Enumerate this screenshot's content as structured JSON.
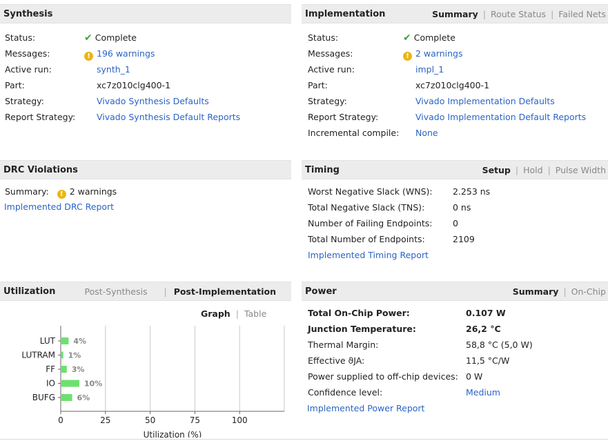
{
  "synthesis": {
    "title": "Synthesis",
    "rows": [
      {
        "label": "Status:",
        "value": "Complete",
        "icon": "check-icon"
      },
      {
        "label": "Messages:",
        "value": "196 warnings",
        "icon": "warning-icon",
        "link": true
      },
      {
        "label": "Active run:",
        "value": "synth_1",
        "link": true
      },
      {
        "label": "Part:",
        "value": "xc7z010clg400-1"
      },
      {
        "label": "Strategy:",
        "value": "Vivado Synthesis Defaults",
        "link": true
      },
      {
        "label": "Report Strategy:",
        "value": "Vivado Synthesis Default Reports",
        "link": true
      }
    ]
  },
  "implementation": {
    "title": "Implementation",
    "tabs": [
      "Summary",
      "Route Status",
      "Failed Nets"
    ],
    "active_tab": "Summary",
    "rows": [
      {
        "label": "Status:",
        "value": "Complete",
        "icon": "check-icon"
      },
      {
        "label": "Messages:",
        "value": "2 warnings",
        "icon": "warning-icon",
        "link": true
      },
      {
        "label": "Active run:",
        "value": "impl_1",
        "link": true
      },
      {
        "label": "Part:",
        "value": "xc7z010clg400-1"
      },
      {
        "label": "Strategy:",
        "value": "Vivado Implementation Defaults",
        "link": true
      },
      {
        "label": "Report Strategy:",
        "value": "Vivado Implementation Default Reports",
        "link": true
      },
      {
        "label": "Incremental compile:",
        "value": "None",
        "link": true
      }
    ]
  },
  "drc": {
    "title": "DRC Violations",
    "summary_label": "Summary:",
    "summary_value": "2 warnings",
    "report_link": "Implemented DRC Report"
  },
  "timing": {
    "title": "Timing",
    "tabs": [
      "Setup",
      "Hold",
      "Pulse Width"
    ],
    "active_tab": "Setup",
    "rows": [
      {
        "label": "Worst Negative Slack (WNS):",
        "value": "2.253 ns"
      },
      {
        "label": "Total Negative Slack (TNS):",
        "value": "0 ns"
      },
      {
        "label": "Number of Failing Endpoints:",
        "value": "0"
      },
      {
        "label": "Total Number of Endpoints:",
        "value": "2109"
      }
    ],
    "report_link": "Implemented Timing Report"
  },
  "utilization": {
    "title": "Utilization",
    "tabs": [
      "Post-Synthesis",
      "Post-Implementation"
    ],
    "active_tab": "Post-Implementation",
    "view_tabs": [
      "Graph",
      "Table"
    ],
    "active_view": "Graph"
  },
  "power": {
    "title": "Power",
    "tabs": [
      "Summary",
      "On-Chip"
    ],
    "active_tab": "Summary",
    "rows": [
      {
        "label": "Total On-Chip Power:",
        "value": "0.107 W",
        "bold": true
      },
      {
        "label": "Junction Temperature:",
        "value": "26,2 °C",
        "bold": true
      },
      {
        "label": "Thermal Margin:",
        "value": "58,8 °C (5,0 W)"
      },
      {
        "label": "Effective ϑJA:",
        "value": "11,5 °C/W"
      },
      {
        "label": "Power supplied to off-chip devices:",
        "value": "0 W"
      },
      {
        "label": "Confidence level:",
        "value": "Medium",
        "link": true
      }
    ],
    "report_link": "Implemented Power Report"
  },
  "chart_data": {
    "type": "bar",
    "orientation": "horizontal",
    "categories": [
      "LUT",
      "LUTRAM",
      "FF",
      "IO",
      "BUFG"
    ],
    "values": [
      4,
      1,
      3,
      10,
      6
    ],
    "value_labels": [
      "4%",
      "1%",
      "3%",
      "10%",
      "6%"
    ],
    "xlabel": "Utilization (%)",
    "xlim": [
      0,
      125
    ],
    "xticks": [
      0,
      25,
      50,
      75,
      100
    ],
    "bar_color": "#6ee06e",
    "grid": true
  }
}
